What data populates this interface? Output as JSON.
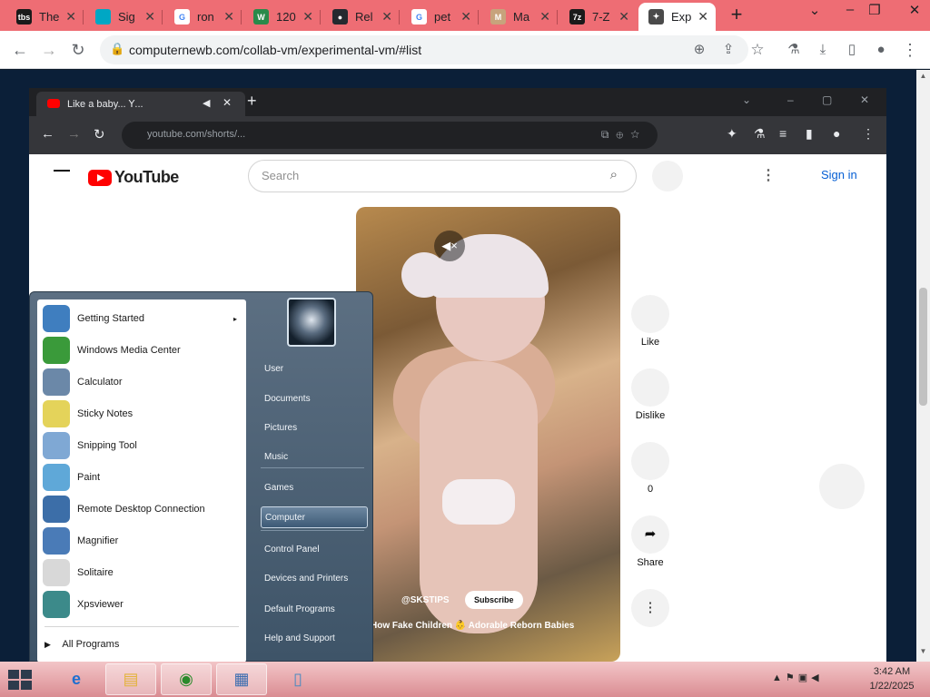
{
  "outer_tabs": [
    {
      "title": "The",
      "icon": "tbs-icon",
      "color": "#1a1a1a",
      "glyph": "tbs"
    },
    {
      "title": "Sig",
      "icon": "signal-icon",
      "color": "#00a7c4",
      "glyph": ""
    },
    {
      "title": "ron",
      "icon": "google-icon",
      "color": "#ffffff",
      "glyph": "G"
    },
    {
      "title": "120",
      "icon": "wikipedia-icon",
      "color": "#2a8a4a",
      "glyph": "W"
    },
    {
      "title": "Rel",
      "icon": "github-icon",
      "color": "#24292f",
      "glyph": "●"
    },
    {
      "title": "pet",
      "icon": "google-icon",
      "color": "#ffffff",
      "glyph": "G"
    },
    {
      "title": "Ma",
      "icon": "map-icon",
      "color": "#c7a37c",
      "glyph": "M"
    },
    {
      "title": "7-Z",
      "icon": "7zip-icon",
      "color": "#1a1a1a",
      "glyph": "7z"
    },
    {
      "title": "Exp",
      "icon": "collabvm-icon",
      "color": "#4a4a4a",
      "glyph": "✦"
    }
  ],
  "toolbar": {
    "url": "computernewb.com/collab-vm/experimental-vm/#list"
  },
  "vm": {
    "tab_title": "Like a baby... 𝖸...",
    "url": "youtube.com/shorts/...",
    "youtube": {
      "logo": "YouTube",
      "search_placeholder": "Search",
      "sign_in": "Sign in",
      "channel": "@SKSTIPS",
      "subscribe": "Subscribe",
      "caption": "How Fake Children 👶 Adorable Reborn Babies",
      "actions": [
        {
          "icon": "like-icon",
          "glyph": "",
          "label": "Like"
        },
        {
          "icon": "dislike-icon",
          "glyph": "",
          "label": "Dislike"
        },
        {
          "icon": "comment-icon",
          "glyph": "",
          "label": "0"
        },
        {
          "icon": "share-icon",
          "glyph": "➦",
          "label": "Share"
        },
        {
          "icon": "more-icon",
          "glyph": "⋮",
          "label": ""
        }
      ]
    },
    "start_menu": {
      "left_items": [
        {
          "label": "Getting Started",
          "color": "#3f7ebf",
          "arrow": "▸"
        },
        {
          "label": "Windows Media Center",
          "color": "#3a9a3a",
          "arrow": ""
        },
        {
          "label": "Calculator",
          "color": "#6b88a8",
          "arrow": ""
        },
        {
          "label": "Sticky Notes",
          "color": "#e4d35a",
          "arrow": ""
        },
        {
          "label": "Snipping Tool",
          "color": "#7fa8d4",
          "arrow": ""
        },
        {
          "label": "Paint",
          "color": "#5fa8d8",
          "arrow": ""
        },
        {
          "label": "Remote Desktop Connection",
          "color": "#3c6ea8",
          "arrow": ""
        },
        {
          "label": "Magnifier",
          "color": "#4a7bb7",
          "arrow": ""
        },
        {
          "label": "Solitaire",
          "color": "#d8d8d8",
          "arrow": ""
        },
        {
          "label": "Xpsviewer",
          "color": "#3c8a8a",
          "arrow": ""
        }
      ],
      "all_programs": "All Programs",
      "right_items": [
        {
          "label": "User"
        },
        {
          "label": "Documents"
        },
        {
          "label": "Pictures"
        },
        {
          "label": "Music"
        },
        {
          "label": "Games"
        },
        {
          "label": "Computer"
        },
        {
          "label": "Control Panel"
        },
        {
          "label": "Devices and Printers"
        },
        {
          "label": "Default Programs"
        },
        {
          "label": "Help and Support"
        }
      ]
    },
    "taskbar": {
      "time": "3:42 AM",
      "date": "1/22/2025"
    }
  }
}
